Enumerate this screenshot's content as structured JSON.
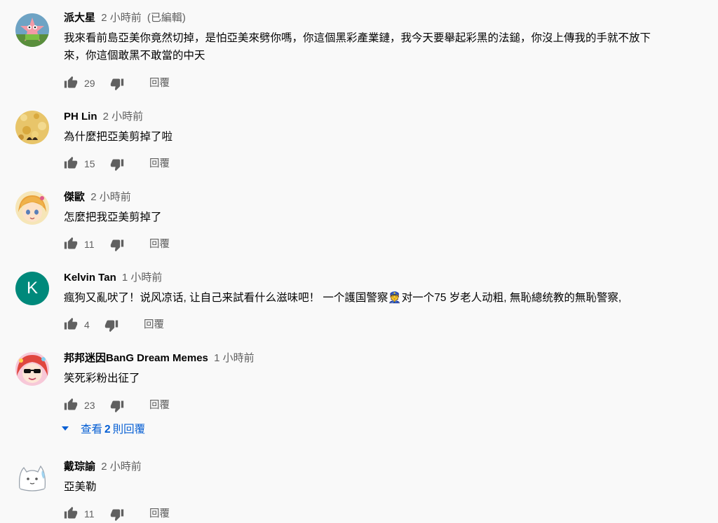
{
  "comments": [
    {
      "author": "派大星",
      "time": "2 小時前",
      "edited": "(已編輯)",
      "lines": [
        "我來看前島亞美你竟然切掉，是怕亞美來劈你嗎，你這個黑彩產業鏈，我今天要舉起彩黑的法鎚，你沒上傳我的手就不放下",
        "來，你這個敢黑不敢當的中天"
      ],
      "likes": "29",
      "reply": "回覆"
    },
    {
      "author": "PH Lin",
      "time": "2 小時前",
      "lines": [
        "為什麼把亞美剪掉了啦"
      ],
      "likes": "15",
      "reply": "回覆"
    },
    {
      "author": "傑歐",
      "time": "2 小時前",
      "lines": [
        "怎麼把我亞美剪掉了"
      ],
      "likes": "11",
      "reply": "回覆"
    },
    {
      "author": "Kelvin Tan",
      "time": "1 小時前",
      "avatar_letter": "K",
      "lines": [
        "瘋狗又亂吠了！说风凉话, 让自己来試看什么滋味吧！ 一个護国警察👮对一个75 岁老人动粗, 無恥總统教的無恥警察,"
      ],
      "likes": "4",
      "reply": "回覆"
    },
    {
      "author": "邦邦迷因BanG Dream Memes",
      "time": "1 小時前",
      "lines": [
        "笑死彩粉出征了"
      ],
      "likes": "23",
      "reply": "回覆"
    },
    {
      "author": "戴琮諭",
      "time": "2 小時前",
      "lines": [
        "亞美勒"
      ],
      "likes": "11",
      "reply": "回覆"
    }
  ],
  "view_replies": {
    "prefix": "查看",
    "count": "2",
    "suffix": "則回覆"
  },
  "colors": {
    "link": "#065fd4",
    "meta": "#606060",
    "kelvin_avatar": "#00897b"
  }
}
